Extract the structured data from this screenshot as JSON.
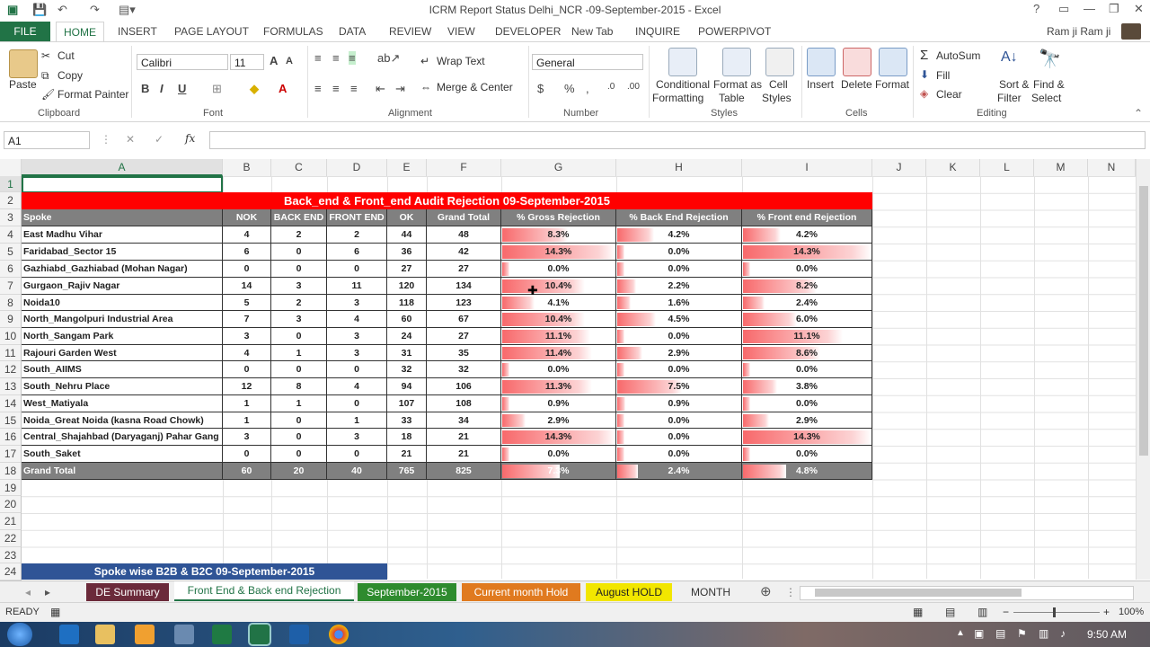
{
  "window": {
    "title": "ICRM Report Status Delhi_NCR -09-September-2015 - Excel",
    "user": "Ram ji Ram ji",
    "qat_icons": [
      "excel-logo-icon",
      "save-icon",
      "undo-icon",
      "redo-icon",
      "customize-icon"
    ],
    "controls": [
      "?",
      "▭",
      "—",
      "❐",
      "✕"
    ]
  },
  "ribbon_tabs": [
    "FILE",
    "HOME",
    "INSERT",
    "PAGE LAYOUT",
    "FORMULAS",
    "DATA",
    "REVIEW",
    "VIEW",
    "DEVELOPER",
    "New Tab",
    "INQUIRE",
    "POWERPIVOT"
  ],
  "ribbon": {
    "clipboard": {
      "paste": "Paste",
      "cut": "Cut",
      "copy": "Copy",
      "format_painter": "Format Painter",
      "label": "Clipboard"
    },
    "font": {
      "name": "Calibri",
      "size": "11",
      "label": "Font"
    },
    "alignment": {
      "wrap": "Wrap Text",
      "merge": "Merge & Center",
      "label": "Alignment"
    },
    "number": {
      "format": "General",
      "label": "Number"
    },
    "styles": {
      "conditional": "Conditional",
      "formatting": "Formatting",
      "format_as": "Format as",
      "table": "Table",
      "cell": "Cell",
      "styles": "Styles",
      "label": "Styles"
    },
    "cells": {
      "insert": "Insert",
      "delete": "Delete",
      "format": "Format",
      "label": "Cells"
    },
    "editing": {
      "autosum": "AutoSum",
      "fill": "Fill",
      "clear": "Clear",
      "sort": "Sort &",
      "filter": "Filter",
      "find": "Find &",
      "select": "Select",
      "label": "Editing"
    }
  },
  "formula_bar": {
    "name_box": "A1",
    "fx": "fx",
    "formula": ""
  },
  "columns": [
    "A",
    "B",
    "C",
    "D",
    "E",
    "F",
    "G",
    "H",
    "I",
    "J",
    "K",
    "L",
    "M",
    "N"
  ],
  "rows": [
    "1",
    "2",
    "3",
    "4",
    "5",
    "6",
    "7",
    "8",
    "9",
    "10",
    "11",
    "12",
    "13",
    "14",
    "15",
    "16",
    "17",
    "18",
    "19",
    "20",
    "21",
    "22",
    "23",
    "24"
  ],
  "report": {
    "title": "Back_end & Front_end Audit Rejection 09-September-2015",
    "headers": [
      "Spoke",
      "NOK",
      "BACK END",
      "FRONT END",
      "OK",
      "Grand Total",
      "% Gross Rejection",
      "% Back End Rejection",
      "% Front end Rejection"
    ],
    "rows": [
      {
        "spoke": "East Madhu Vihar",
        "nok": "4",
        "back": "2",
        "front": "2",
        "ok": "44",
        "total": "48",
        "gross": "8.3%",
        "back_pct": "4.2%",
        "front_pct": "4.2%",
        "g": 8.3,
        "b": 4.2,
        "f": 4.2
      },
      {
        "spoke": "Faridabad_Sector 15",
        "nok": "6",
        "back": "0",
        "front": "6",
        "ok": "36",
        "total": "42",
        "gross": "14.3%",
        "back_pct": "0.0%",
        "front_pct": "14.3%",
        "g": 14.3,
        "b": 0,
        "f": 14.3
      },
      {
        "spoke": "Gazhiabd_Gazhiabad (Mohan Nagar)",
        "nok": "0",
        "back": "0",
        "front": "0",
        "ok": "27",
        "total": "27",
        "gross": "0.0%",
        "back_pct": "0.0%",
        "front_pct": "0.0%",
        "g": 0,
        "b": 0,
        "f": 0
      },
      {
        "spoke": "Gurgaon_Rajiv Nagar",
        "nok": "14",
        "back": "3",
        "front": "11",
        "ok": "120",
        "total": "134",
        "gross": "10.4%",
        "back_pct": "2.2%",
        "front_pct": "8.2%",
        "g": 10.4,
        "b": 2.2,
        "f": 8.2
      },
      {
        "spoke": "Noida10",
        "nok": "5",
        "back": "2",
        "front": "3",
        "ok": "118",
        "total": "123",
        "gross": "4.1%",
        "back_pct": "1.6%",
        "front_pct": "2.4%",
        "g": 4.1,
        "b": 1.6,
        "f": 2.4
      },
      {
        "spoke": "North_Mangolpuri Industrial Area",
        "nok": "7",
        "back": "3",
        "front": "4",
        "ok": "60",
        "total": "67",
        "gross": "10.4%",
        "back_pct": "4.5%",
        "front_pct": "6.0%",
        "g": 10.4,
        "b": 4.5,
        "f": 6.0
      },
      {
        "spoke": "North_Sangam Park",
        "nok": "3",
        "back": "0",
        "front": "3",
        "ok": "24",
        "total": "27",
        "gross": "11.1%",
        "back_pct": "0.0%",
        "front_pct": "11.1%",
        "g": 11.1,
        "b": 0,
        "f": 11.1
      },
      {
        "spoke": "Rajouri Garden West",
        "nok": "4",
        "back": "1",
        "front": "3",
        "ok": "31",
        "total": "35",
        "gross": "11.4%",
        "back_pct": "2.9%",
        "front_pct": "8.6%",
        "g": 11.4,
        "b": 2.9,
        "f": 8.6
      },
      {
        "spoke": "South_AIIMS",
        "nok": "0",
        "back": "0",
        "front": "0",
        "ok": "32",
        "total": "32",
        "gross": "0.0%",
        "back_pct": "0.0%",
        "front_pct": "0.0%",
        "g": 0,
        "b": 0,
        "f": 0
      },
      {
        "spoke": "South_Nehru Place",
        "nok": "12",
        "back": "8",
        "front": "4",
        "ok": "94",
        "total": "106",
        "gross": "11.3%",
        "back_pct": "7.5%",
        "front_pct": "3.8%",
        "g": 11.3,
        "b": 7.5,
        "f": 3.8
      },
      {
        "spoke": "West_Matiyala",
        "nok": "1",
        "back": "1",
        "front": "0",
        "ok": "107",
        "total": "108",
        "gross": "0.9%",
        "back_pct": "0.9%",
        "front_pct": "0.0%",
        "g": 0.9,
        "b": 0.9,
        "f": 0
      },
      {
        "spoke": "Noida_Great Noida (kasna Road Chowk)",
        "nok": "1",
        "back": "0",
        "front": "1",
        "ok": "33",
        "total": "34",
        "gross": "2.9%",
        "back_pct": "0.0%",
        "front_pct": "2.9%",
        "g": 2.9,
        "b": 0,
        "f": 2.9
      },
      {
        "spoke": "Central_Shajahbad (Daryaganj) Pahar Gang",
        "nok": "3",
        "back": "0",
        "front": "3",
        "ok": "18",
        "total": "21",
        "gross": "14.3%",
        "back_pct": "0.0%",
        "front_pct": "14.3%",
        "g": 14.3,
        "b": 0,
        "f": 14.3
      },
      {
        "spoke": "South_Saket",
        "nok": "0",
        "back": "0",
        "front": "0",
        "ok": "21",
        "total": "21",
        "gross": "0.0%",
        "back_pct": "0.0%",
        "front_pct": "0.0%",
        "g": 0,
        "b": 0,
        "f": 0
      }
    ],
    "grand_total": {
      "spoke": "Grand Total",
      "nok": "60",
      "back": "20",
      "front": "40",
      "ok": "765",
      "total": "825",
      "gross": "7.3%",
      "back_pct": "2.4%",
      "front_pct": "4.8%",
      "g": 7.3,
      "b": 2.4,
      "f": 4.8
    }
  },
  "row24_banner": "Spoke wise B2B & B2C 09-September-2015",
  "sheet_tabs": [
    {
      "label": "DE Summary",
      "color": "#6b2a3a",
      "text": "#fff"
    },
    {
      "label": "Front End & Back end Rejection",
      "color": "#ffffff",
      "text": "#217346"
    },
    {
      "label": "September-2015",
      "color": "#2e8b2e",
      "text": "#fff"
    },
    {
      "label": "Current month Hold",
      "color": "#e07a1f",
      "text": "#fff"
    },
    {
      "label": "August HOLD",
      "color": "#f2e600",
      "text": "#222"
    },
    {
      "label": "MONTH ...",
      "color": "#f0f0f0",
      "text": "#333"
    }
  ],
  "status": {
    "ready": "READY",
    "zoom": "100%"
  },
  "taskbar": {
    "time": "9:50 AM"
  },
  "colors": {
    "accent": "#217346",
    "title_red": "#ff0000",
    "header_gray": "#808080",
    "banner_blue": "#2f5496"
  }
}
